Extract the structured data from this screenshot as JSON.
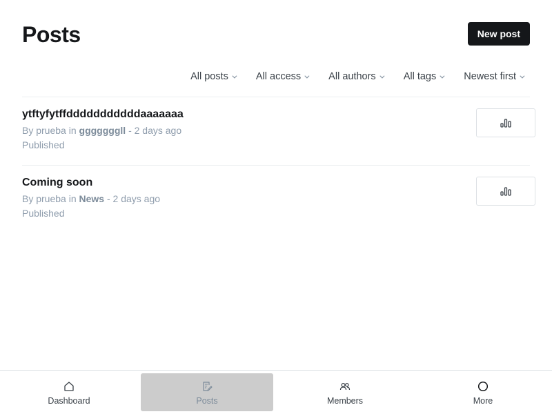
{
  "header": {
    "title": "Posts",
    "new_post_label": "New post"
  },
  "filters": [
    {
      "label": "All posts"
    },
    {
      "label": "All access"
    },
    {
      "label": "All authors"
    },
    {
      "label": "All tags"
    },
    {
      "label": "Newest first"
    }
  ],
  "posts": [
    {
      "title": "ytftyfytffdddddddddddaaaaaaa",
      "by_prefix": "By",
      "author": "prueba",
      "in_word": "in",
      "tag": "gggggggll",
      "time": "- 2 days ago",
      "status": "Published",
      "analytics_icon": "bar-chart-icon"
    },
    {
      "title": "Coming soon",
      "by_prefix": "By",
      "author": "prueba",
      "in_word": "in",
      "tag": "News",
      "time": "- 2 days ago",
      "status": "Published",
      "analytics_icon": "bar-chart-icon"
    }
  ],
  "bottom_nav": {
    "active": "Posts",
    "items": [
      {
        "label": "Dashboard",
        "icon": "home-icon"
      },
      {
        "label": "Posts",
        "icon": "edit-post-icon"
      },
      {
        "label": "Members",
        "icon": "members-icon"
      },
      {
        "label": "More",
        "icon": "circle-icon"
      }
    ]
  },
  "colors": {
    "primary_button": "#15171a",
    "active_nav_bg": "#cccccc",
    "meta_text": "#8e9cac"
  }
}
